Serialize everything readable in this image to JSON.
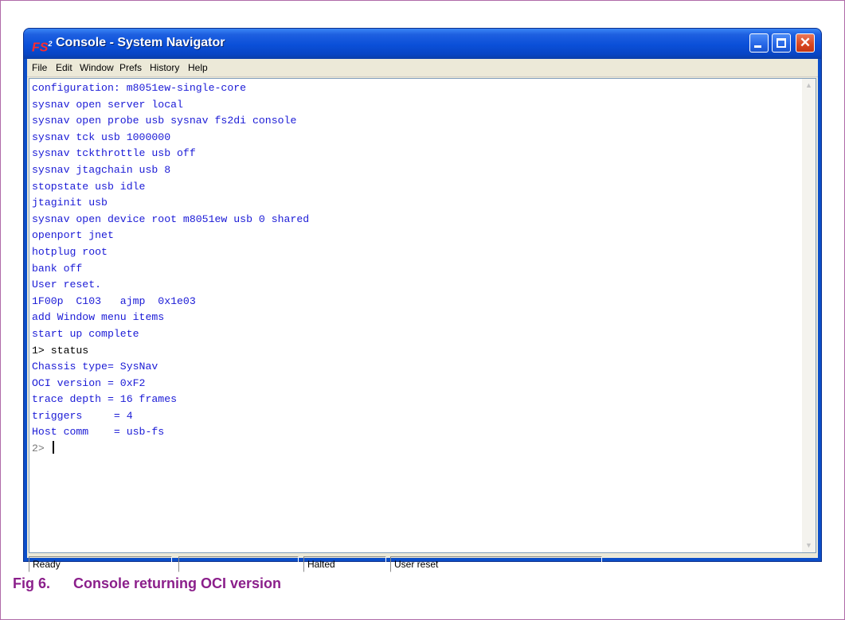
{
  "window": {
    "title": "Console - System Navigator",
    "app_icon_text": "FS",
    "app_icon_sup": "2",
    "minimize_glyph": "_",
    "maximize_glyph": "□",
    "close_glyph": "✕"
  },
  "menu": [
    "File",
    "Edit",
    "Window",
    "Prefs",
    "History",
    "Help"
  ],
  "console_lines": [
    {
      "text": "configuration: m8051ew-single-core",
      "kind": "out"
    },
    {
      "text": "sysnav open server local",
      "kind": "out"
    },
    {
      "text": "sysnav open probe usb sysnav fs2di console",
      "kind": "out"
    },
    {
      "text": "sysnav tck usb 1000000",
      "kind": "out"
    },
    {
      "text": "sysnav tckthrottle usb off",
      "kind": "out"
    },
    {
      "text": "sysnav jtagchain usb 8",
      "kind": "out"
    },
    {
      "text": "stopstate usb idle",
      "kind": "out"
    },
    {
      "text": "jtaginit usb",
      "kind": "out"
    },
    {
      "text": "sysnav open device root m8051ew usb 0 shared",
      "kind": "out"
    },
    {
      "text": "openport jnet",
      "kind": "out"
    },
    {
      "text": "hotplug root",
      "kind": "out"
    },
    {
      "text": "bank off",
      "kind": "out"
    },
    {
      "text": "User reset.",
      "kind": "out"
    },
    {
      "text": "1F00p  C103   ajmp  0x1e03",
      "kind": "out"
    },
    {
      "text": "add Window menu items",
      "kind": "out"
    },
    {
      "text": "start up complete",
      "kind": "out"
    },
    {
      "text": "1> status",
      "kind": "cmd"
    },
    {
      "text": "Chassis type= SysNav",
      "kind": "out"
    },
    {
      "text": "OCI version = 0xF2",
      "kind": "out"
    },
    {
      "text": "trace depth = 16 frames",
      "kind": "out"
    },
    {
      "text": "triggers     = 4",
      "kind": "out"
    },
    {
      "text": "Host comm    = usb-fs",
      "kind": "out"
    },
    {
      "text": "2> ",
      "kind": "prompt"
    }
  ],
  "status": {
    "pane1": "Ready",
    "pane2": "",
    "pane3": "Halted",
    "pane4": "User reset"
  },
  "scroll": {
    "up": "▲",
    "down": "▼"
  },
  "caption": {
    "number": "Fig 6.",
    "text": "Console returning OCI version"
  },
  "colors": {
    "console_text": "#1a1ad6",
    "caption": "#8b1f8b",
    "titlebar": "#0a4fd8"
  }
}
